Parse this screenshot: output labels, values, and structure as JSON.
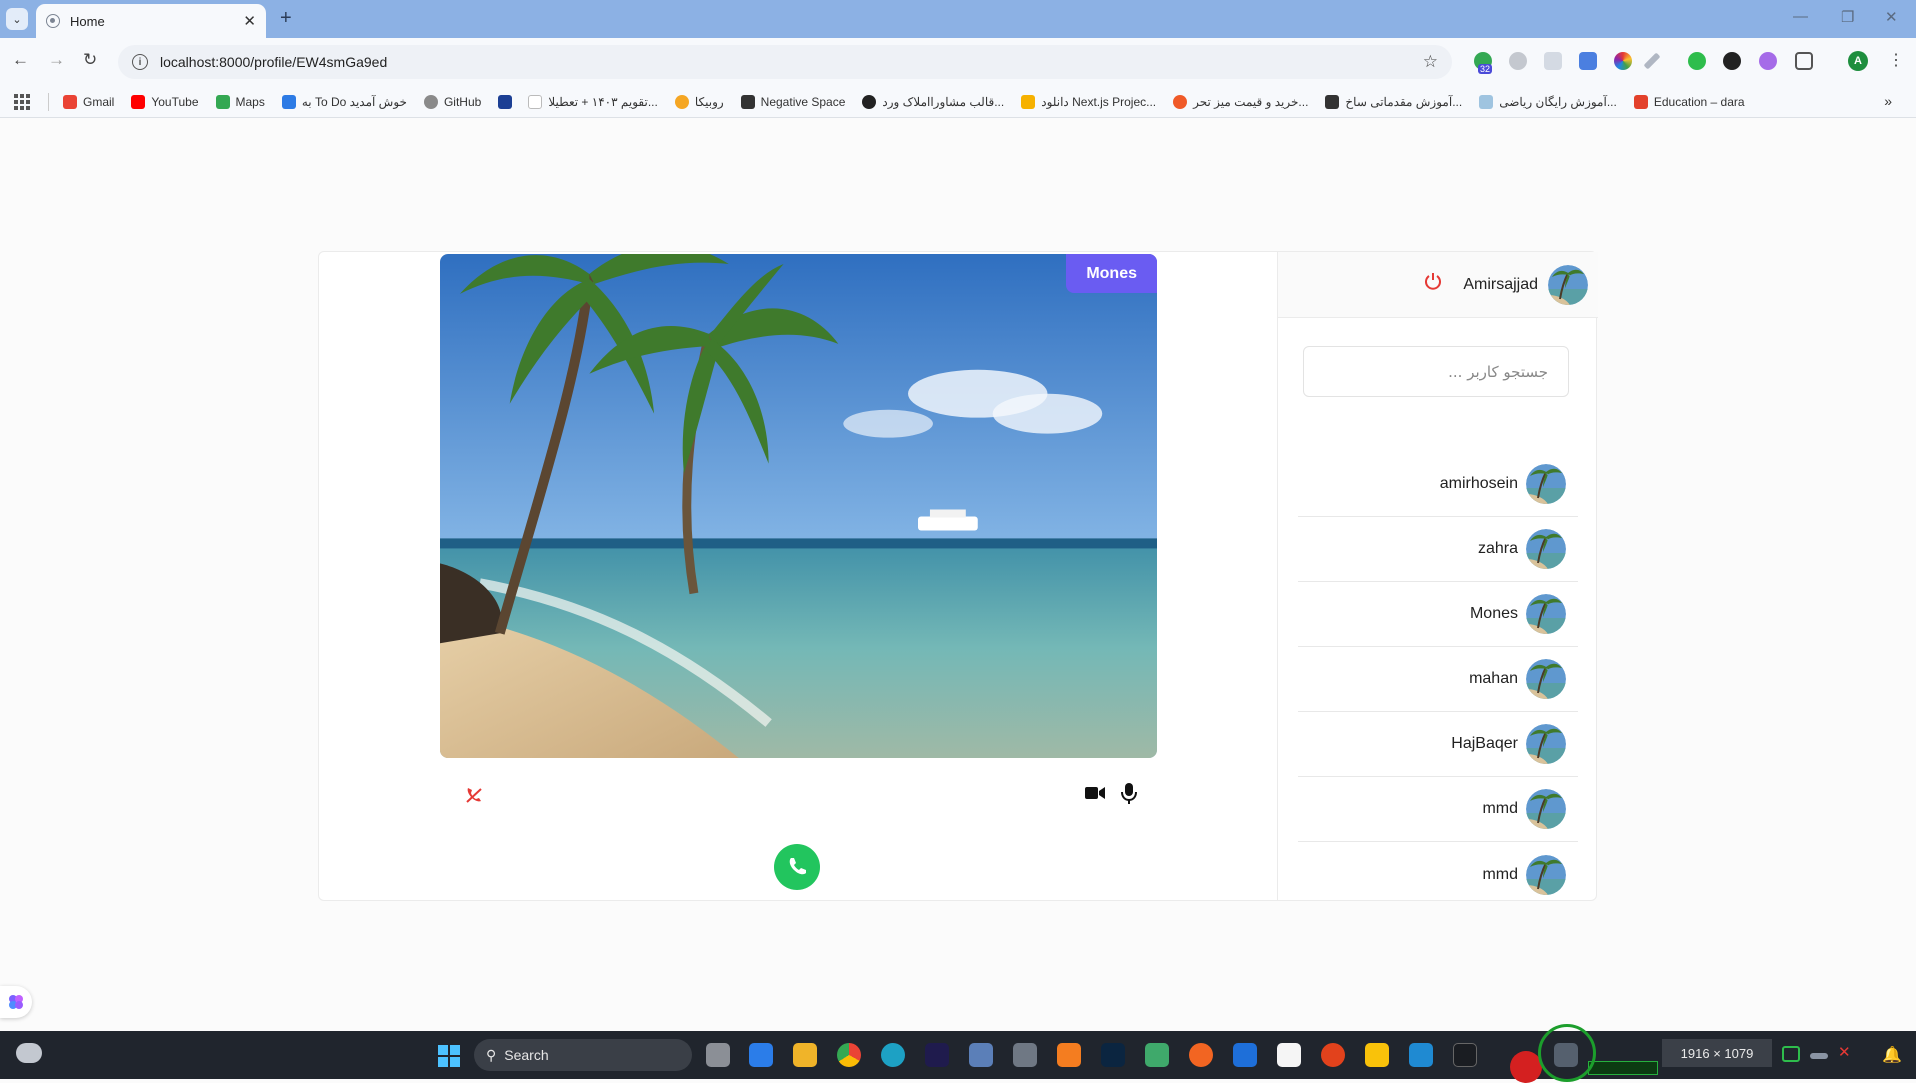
{
  "browser": {
    "tab_title": "Home",
    "url": "localhost:8000/profile/EW4smGa9ed",
    "profile_initial": "A",
    "extension_badge": "32",
    "bookmarks": [
      {
        "label": "Gmail",
        "color": "#ea4335"
      },
      {
        "label": "YouTube",
        "color": "#ff0000"
      },
      {
        "label": "Maps",
        "color": "#34a853"
      },
      {
        "label": "به To Do خوش آمدید",
        "color": "#2d7be5"
      },
      {
        "label": "GitHub",
        "color": "#8a8a8a"
      },
      {
        "label": "",
        "color": "#1c3f94"
      },
      {
        "label": "تقویم ۱۴۰۳ + تعطیلا...",
        "color": "#ffffff"
      },
      {
        "label": "روبیکا",
        "color": "#f5a623"
      },
      {
        "label": "Negative Space",
        "color": "#333333"
      },
      {
        "label": "قالب مشاورااملاک ورد...",
        "color": "#222222"
      },
      {
        "label": "دانلود Next.js Projec...",
        "color": "#f6b100"
      },
      {
        "label": "خرید و قیمت میز تحر...",
        "color": "#f05a28"
      },
      {
        "label": "آموزش مقدماتی ساخ...",
        "color": "#333333"
      },
      {
        "label": "آموزش رایگان ریاضی...",
        "color": "#9fc4e0"
      },
      {
        "label": "Education – dara",
        "color": "#e3412b"
      }
    ]
  },
  "app": {
    "peer_name": "Mones",
    "current_user": "Amirsajjad",
    "search_placeholder": "جستجو کاربر ...",
    "users": [
      {
        "name": "amirhosein"
      },
      {
        "name": "zahra"
      },
      {
        "name": "Mones"
      },
      {
        "name": "mahan"
      },
      {
        "name": "HajBaqer"
      },
      {
        "name": "mmd"
      },
      {
        "name": "mmd"
      }
    ],
    "colors": {
      "accent": "#6a5cf2",
      "call_green": "#22c55e",
      "hangup_red": "#e53935"
    }
  },
  "taskbar": {
    "search_label": "Search",
    "screen_dimensions": "1916 × 1079"
  }
}
